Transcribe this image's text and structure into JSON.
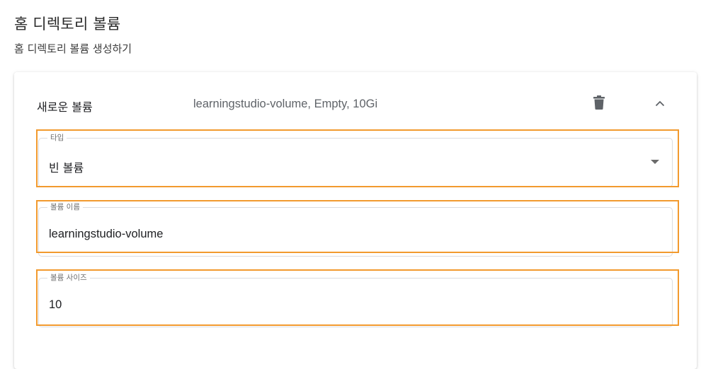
{
  "section": {
    "title": "홈 디렉토리 볼륨",
    "subtitle": "홈 디렉토리 볼륨 생성하기"
  },
  "volume_card": {
    "header_title": "새로운 볼륨",
    "header_summary": "learningstudio-volume, Empty, 10Gi",
    "icons": {
      "delete": "trash-icon",
      "collapse": "chevron-up-icon"
    },
    "fields": {
      "type": {
        "label": "타입",
        "value": "빈 볼륨"
      },
      "name": {
        "label": "볼륨 이름",
        "value": "learningstudio-volume"
      },
      "size": {
        "label": "볼륨 사이즈",
        "value": "10"
      }
    }
  },
  "colors": {
    "highlight": "#f29a2e",
    "field_border": "#dadce0",
    "icon": "#5f6368"
  }
}
